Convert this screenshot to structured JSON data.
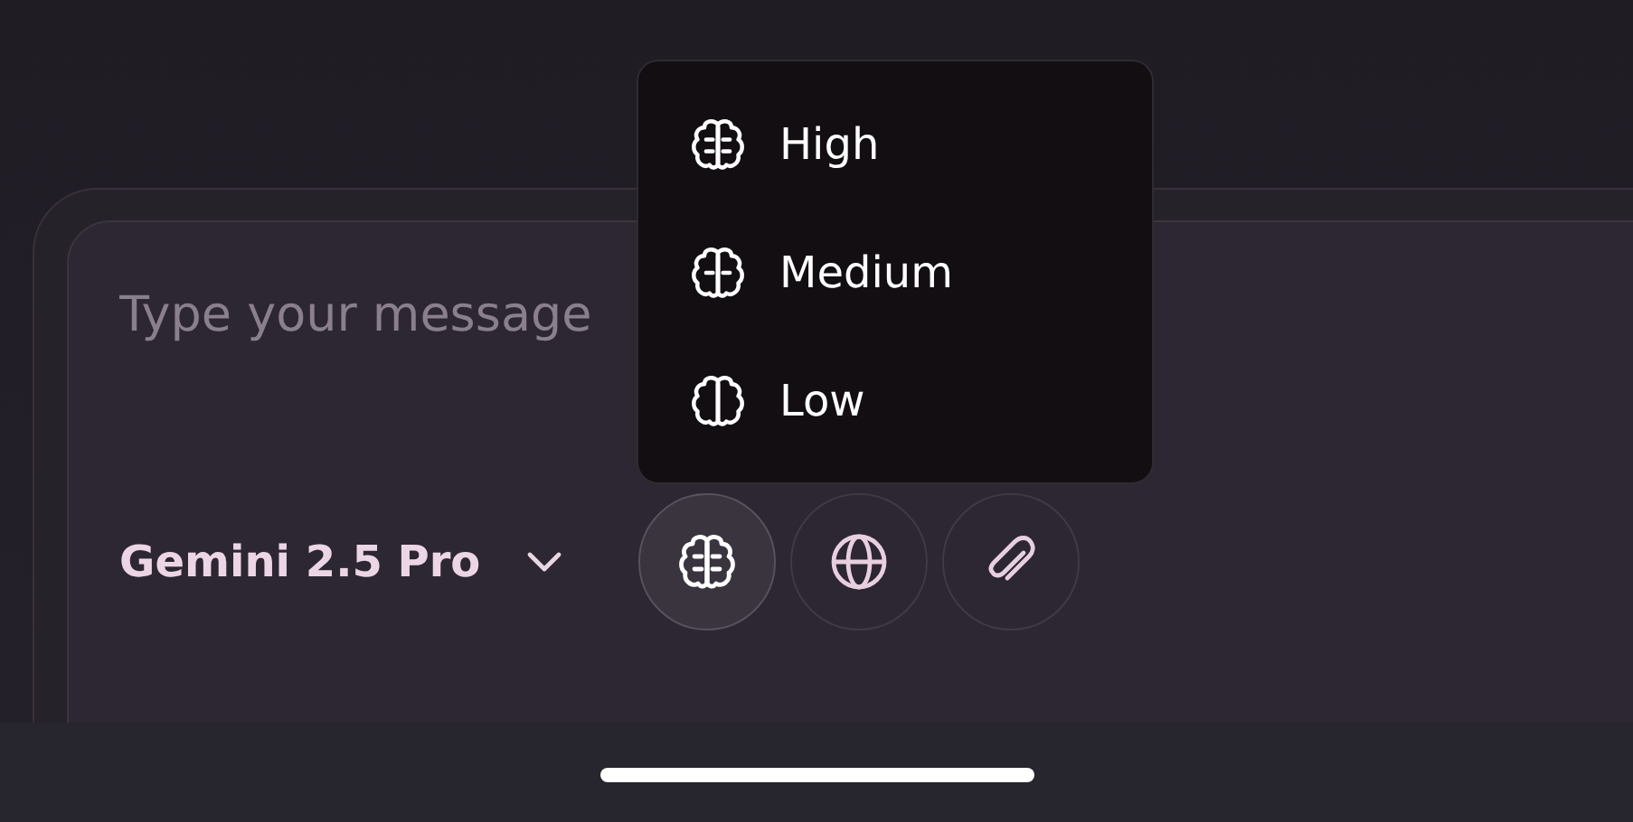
{
  "composer": {
    "placeholder": "Type your message",
    "model": "Gemini 2.5 Pro",
    "tools": [
      {
        "kind": "reasoning",
        "active": true
      },
      {
        "kind": "web",
        "active": false
      },
      {
        "kind": "attach",
        "active": false
      }
    ]
  },
  "menu": {
    "items": [
      {
        "label": "High",
        "kind": "high"
      },
      {
        "label": "Medium",
        "kind": "medium"
      },
      {
        "label": "Low",
        "kind": "low"
      }
    ]
  }
}
